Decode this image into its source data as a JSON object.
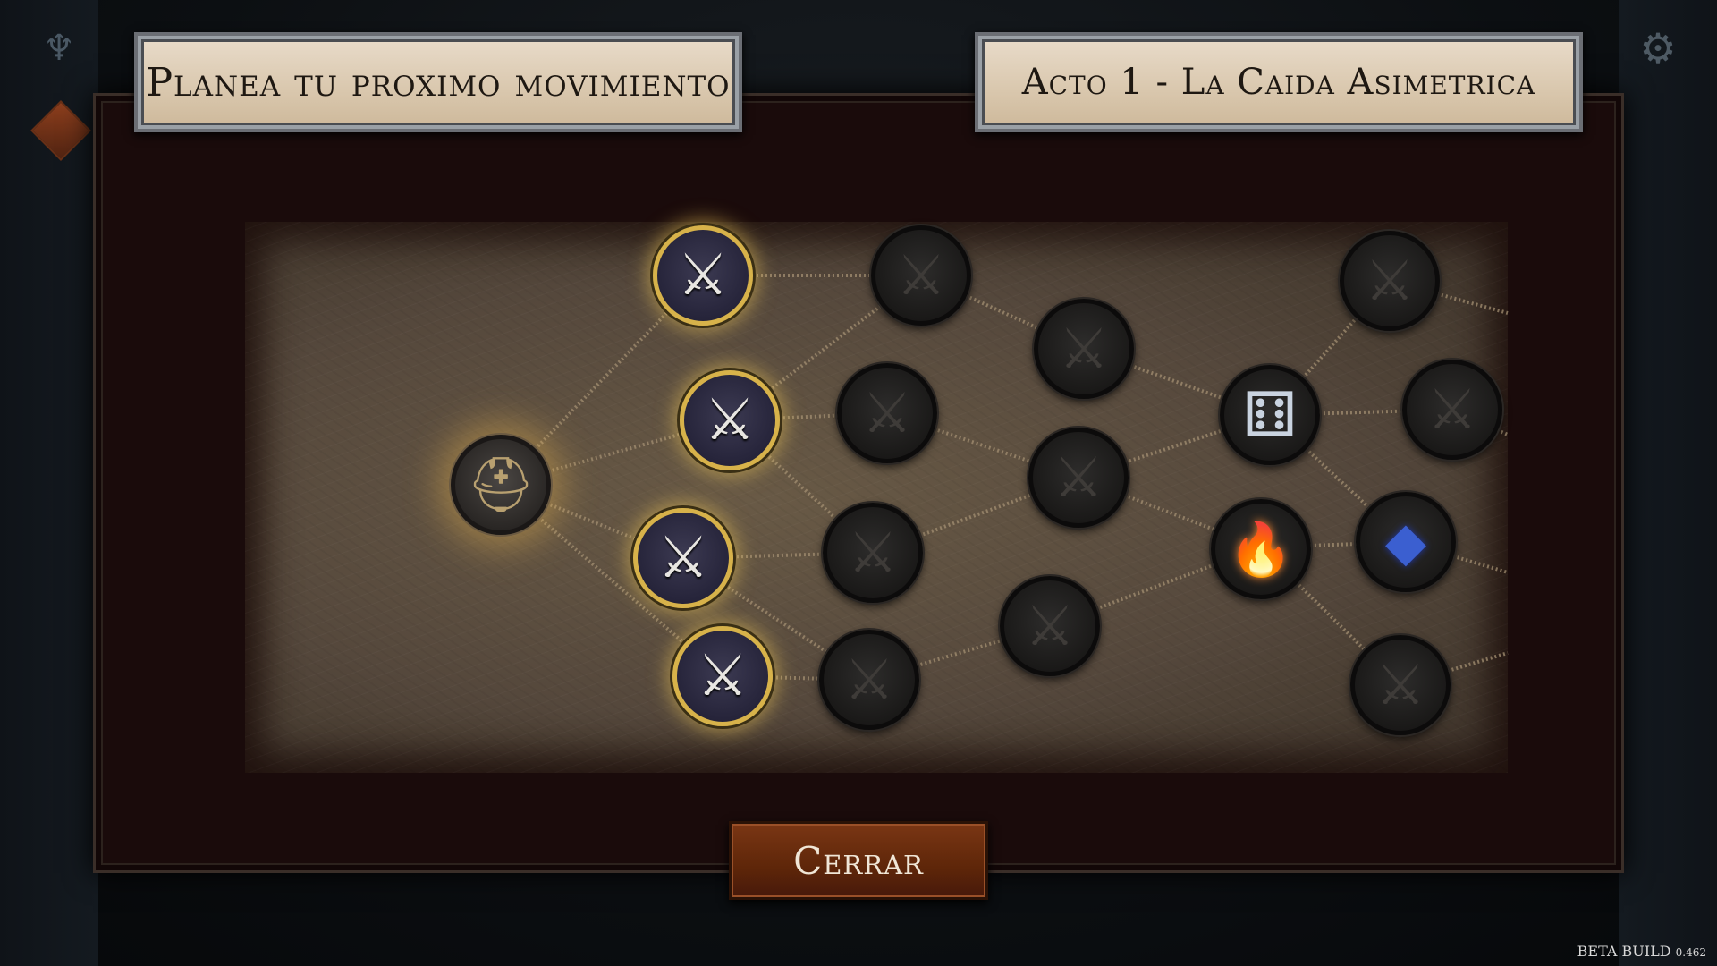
{
  "header": {
    "title": "Planea tu proximo movimiento",
    "act_title": "Acto 1 - La Caida Asimetrica"
  },
  "icons": {
    "logo": "guild-crest-icon",
    "settings": "gear-icon",
    "menu_diamond": "diamond-icon"
  },
  "map": {
    "nodes": [
      {
        "id": "start",
        "type": "start",
        "icon": "viking-helmet-icon",
        "state": "current"
      },
      {
        "id": "c1-a",
        "type": "battle",
        "icon": "crossed-swords-icon",
        "state": "available"
      },
      {
        "id": "c1-b",
        "type": "battle",
        "icon": "crossed-swords-icon",
        "state": "available"
      },
      {
        "id": "c1-c",
        "type": "battle",
        "icon": "crossed-swords-icon",
        "state": "available"
      },
      {
        "id": "c1-d",
        "type": "battle",
        "icon": "crossed-swords-icon",
        "state": "available"
      },
      {
        "id": "c2-a",
        "type": "battle",
        "icon": "crossed-swords-icon",
        "state": "locked"
      },
      {
        "id": "c2-b",
        "type": "battle",
        "icon": "crossed-swords-icon",
        "state": "locked"
      },
      {
        "id": "c2-c",
        "type": "battle",
        "icon": "crossed-swords-icon",
        "state": "locked"
      },
      {
        "id": "c2-d",
        "type": "battle",
        "icon": "crossed-swords-icon",
        "state": "locked"
      },
      {
        "id": "c3-a",
        "type": "battle",
        "icon": "crossed-swords-icon",
        "state": "locked"
      },
      {
        "id": "c3-b",
        "type": "battle",
        "icon": "crossed-swords-icon",
        "state": "locked"
      },
      {
        "id": "c3-c",
        "type": "battle",
        "icon": "crossed-swords-icon",
        "state": "locked"
      },
      {
        "id": "c4-a",
        "type": "event",
        "icon": "dice-icon",
        "state": "locked"
      },
      {
        "id": "c4-b",
        "type": "rest",
        "icon": "campfire-icon",
        "state": "locked"
      },
      {
        "id": "c5-a",
        "type": "battle",
        "icon": "crossed-swords-icon",
        "state": "locked"
      },
      {
        "id": "c5-b",
        "type": "battle",
        "icon": "crossed-swords-icon",
        "state": "locked"
      },
      {
        "id": "c5-c",
        "type": "treasure",
        "icon": "crystal-icon",
        "state": "locked"
      },
      {
        "id": "c5-d",
        "type": "battle",
        "icon": "crossed-swords-icon",
        "state": "locked"
      }
    ]
  },
  "actions": {
    "close_label": "Cerrar"
  },
  "footer": {
    "build_label": "BETA BUILD",
    "build_version": "0.462"
  }
}
